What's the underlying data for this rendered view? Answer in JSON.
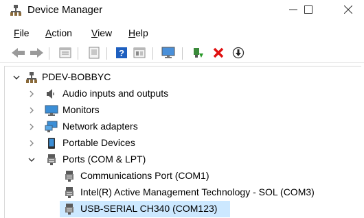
{
  "window": {
    "title": "Device Manager",
    "controls": {
      "minimize": "—",
      "maximize": "☐",
      "close": "✕"
    }
  },
  "menu": {
    "file": {
      "key": "F",
      "rest": "ile"
    },
    "action": {
      "key": "A",
      "rest": "ction"
    },
    "view": {
      "key": "V",
      "rest": "iew"
    },
    "help": {
      "key": "H",
      "rest": "elp"
    }
  },
  "toolbar": {
    "icons": [
      "back-arrow-icon",
      "forward-arrow-icon",
      "properties-icon",
      "show-hidden-icon",
      "help-icon",
      "view-icon",
      "monitor-icon",
      "update-driver-icon",
      "uninstall-icon",
      "download-icon"
    ]
  },
  "tree": {
    "root": {
      "label": "PDEV-BOBBYC",
      "expanded": true
    },
    "categories": [
      {
        "label": "Audio inputs and outputs",
        "expanded": false,
        "icon": "speaker-icon"
      },
      {
        "label": "Monitors",
        "expanded": false,
        "icon": "monitor-icon"
      },
      {
        "label": "Network adapters",
        "expanded": false,
        "icon": "network-icon"
      },
      {
        "label": "Portable Devices",
        "expanded": false,
        "icon": "portable-device-icon"
      },
      {
        "label": "Ports (COM & LPT)",
        "expanded": true,
        "icon": "port-icon"
      }
    ],
    "ports": [
      {
        "label": "Communications Port (COM1)",
        "selected": false
      },
      {
        "label": "Intel(R) Active Management Technology - SOL (COM3)",
        "selected": false
      },
      {
        "label": "USB-SERIAL CH340 (COM123)",
        "selected": true
      }
    ]
  },
  "colors": {
    "selection": "#cce8ff",
    "uninstall_red": "#e01010",
    "help_blue": "#1e5fbf"
  }
}
